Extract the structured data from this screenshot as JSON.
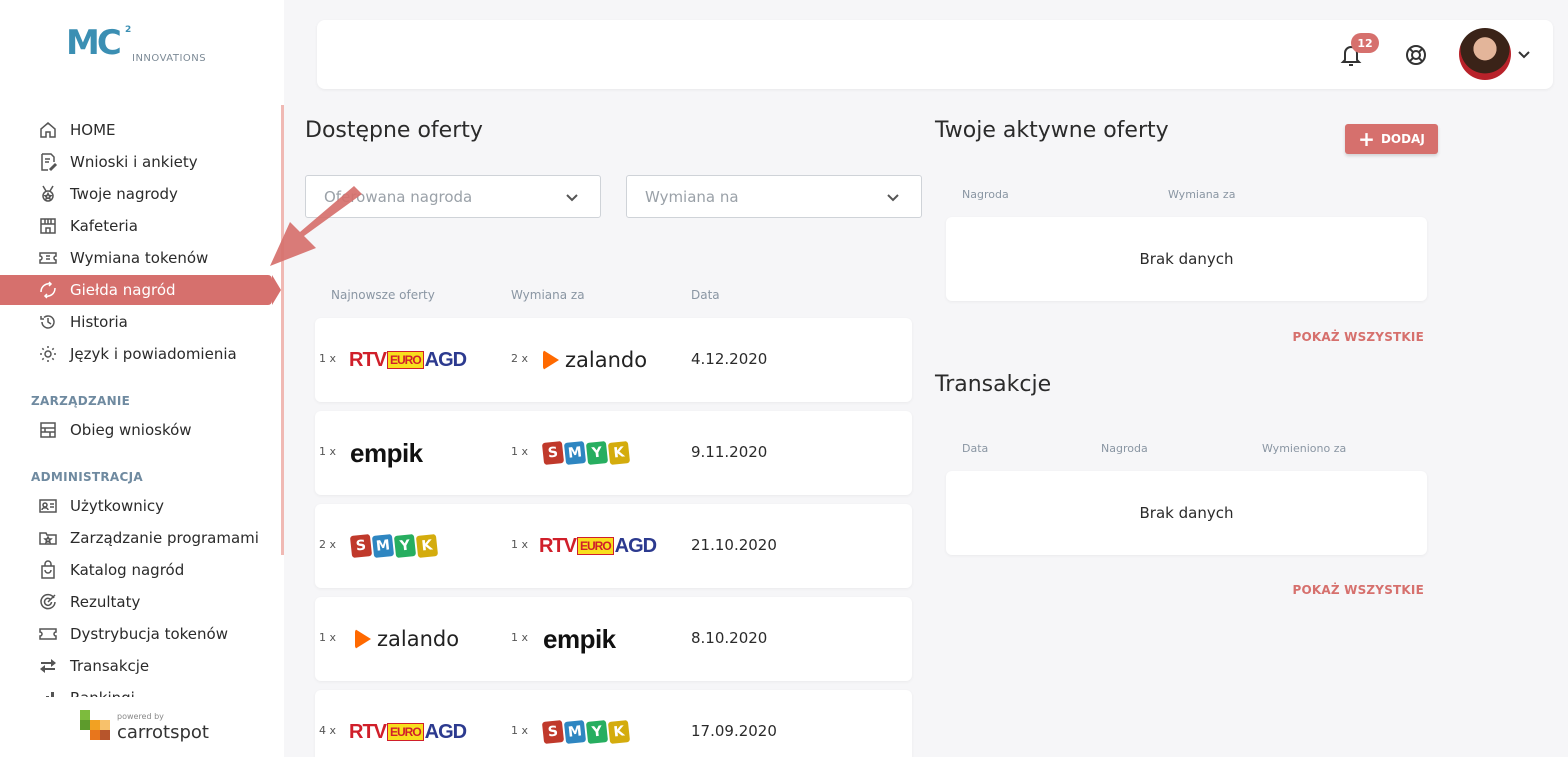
{
  "brand": {
    "mark": "MC",
    "sup": "2",
    "subtitle": "INNOVATIONS"
  },
  "sidebar": {
    "items": [
      {
        "label": "HOME",
        "icon": "home-icon"
      },
      {
        "label": "Wnioski i ankiety",
        "icon": "form-icon"
      },
      {
        "label": "Twoje nagrody",
        "icon": "medal-icon"
      },
      {
        "label": "Kafeteria",
        "icon": "store-icon"
      },
      {
        "label": "Wymiana tokenów",
        "icon": "ticket-icon"
      },
      {
        "label": "Giełda nagród",
        "icon": "exchange-icon",
        "active": true
      },
      {
        "label": "Historia",
        "icon": "history-icon"
      },
      {
        "label": "Język i powiadomienia",
        "icon": "gear-icon"
      }
    ],
    "section_management": "ZARZĄDZANIE",
    "management_items": [
      {
        "label": "Obieg wniosków",
        "icon": "workflow-icon"
      }
    ],
    "section_admin": "ADMINISTRACJA",
    "admin_items": [
      {
        "label": "Użytkownicy",
        "icon": "users-icon"
      },
      {
        "label": "Zarządzanie programami",
        "icon": "folder-star-icon"
      },
      {
        "label": "Katalog nagród",
        "icon": "bag-icon"
      },
      {
        "label": "Rezultaty",
        "icon": "target-icon"
      },
      {
        "label": "Dystrybucja tokenów",
        "icon": "ticket-icon"
      },
      {
        "label": "Transakcje",
        "icon": "transfer-icon"
      },
      {
        "label": "Rankingi",
        "icon": "ranking-icon"
      }
    ],
    "powered_by": "powered by",
    "powered_name": "carrotspot"
  },
  "topbar": {
    "notifications_count": "12"
  },
  "offers": {
    "title": "Dostępne oferty",
    "filter_reward_placeholder": "Oferowana nagroda",
    "filter_exchange_placeholder": "Wymiana na",
    "col_newest": "Najnowsze oferty",
    "col_exchange": "Wymiana za",
    "col_date": "Data",
    "rows": [
      {
        "qty_left": "1 x",
        "left": "rtv",
        "qty_right": "2 x",
        "right": "zalando",
        "date": "4.12.2020"
      },
      {
        "qty_left": "1 x",
        "left": "empik",
        "qty_right": "1 x",
        "right": "smyk",
        "date": "9.11.2020"
      },
      {
        "qty_left": "2 x",
        "left": "smyk",
        "qty_right": "1 x",
        "right": "rtv",
        "date": "21.10.2020"
      },
      {
        "qty_left": "1 x",
        "left": "zalando",
        "qty_right": "1 x",
        "right": "empik",
        "date": "8.10.2020"
      },
      {
        "qty_left": "4 x",
        "left": "rtv",
        "qty_right": "1 x",
        "right": "smyk",
        "date": "17.09.2020"
      }
    ]
  },
  "logos": {
    "rtv": {
      "r": "RTV",
      "e": "EURO",
      "a": "AGD"
    },
    "empik": "empik",
    "zalando": "zalando",
    "smyk": [
      "S",
      "M",
      "Y",
      "K"
    ]
  },
  "active_offers": {
    "title": "Twoje aktywne oferty",
    "add_label": "DODAJ",
    "col_reward": "Nagroda",
    "col_exchange": "Wymiana za",
    "empty": "Brak danych",
    "show_all": "POKAŻ WSZYSTKIE"
  },
  "transactions": {
    "title": "Transakcje",
    "col_date": "Data",
    "col_reward": "Nagroda",
    "col_exchanged": "Wymieniono za",
    "empty": "Brak danych",
    "show_all": "POKAŻ WSZYSTKIE"
  },
  "colors": {
    "accent": "#d6706d",
    "brand_blue": "#3b8fb3",
    "zalando": "#ff6900"
  }
}
